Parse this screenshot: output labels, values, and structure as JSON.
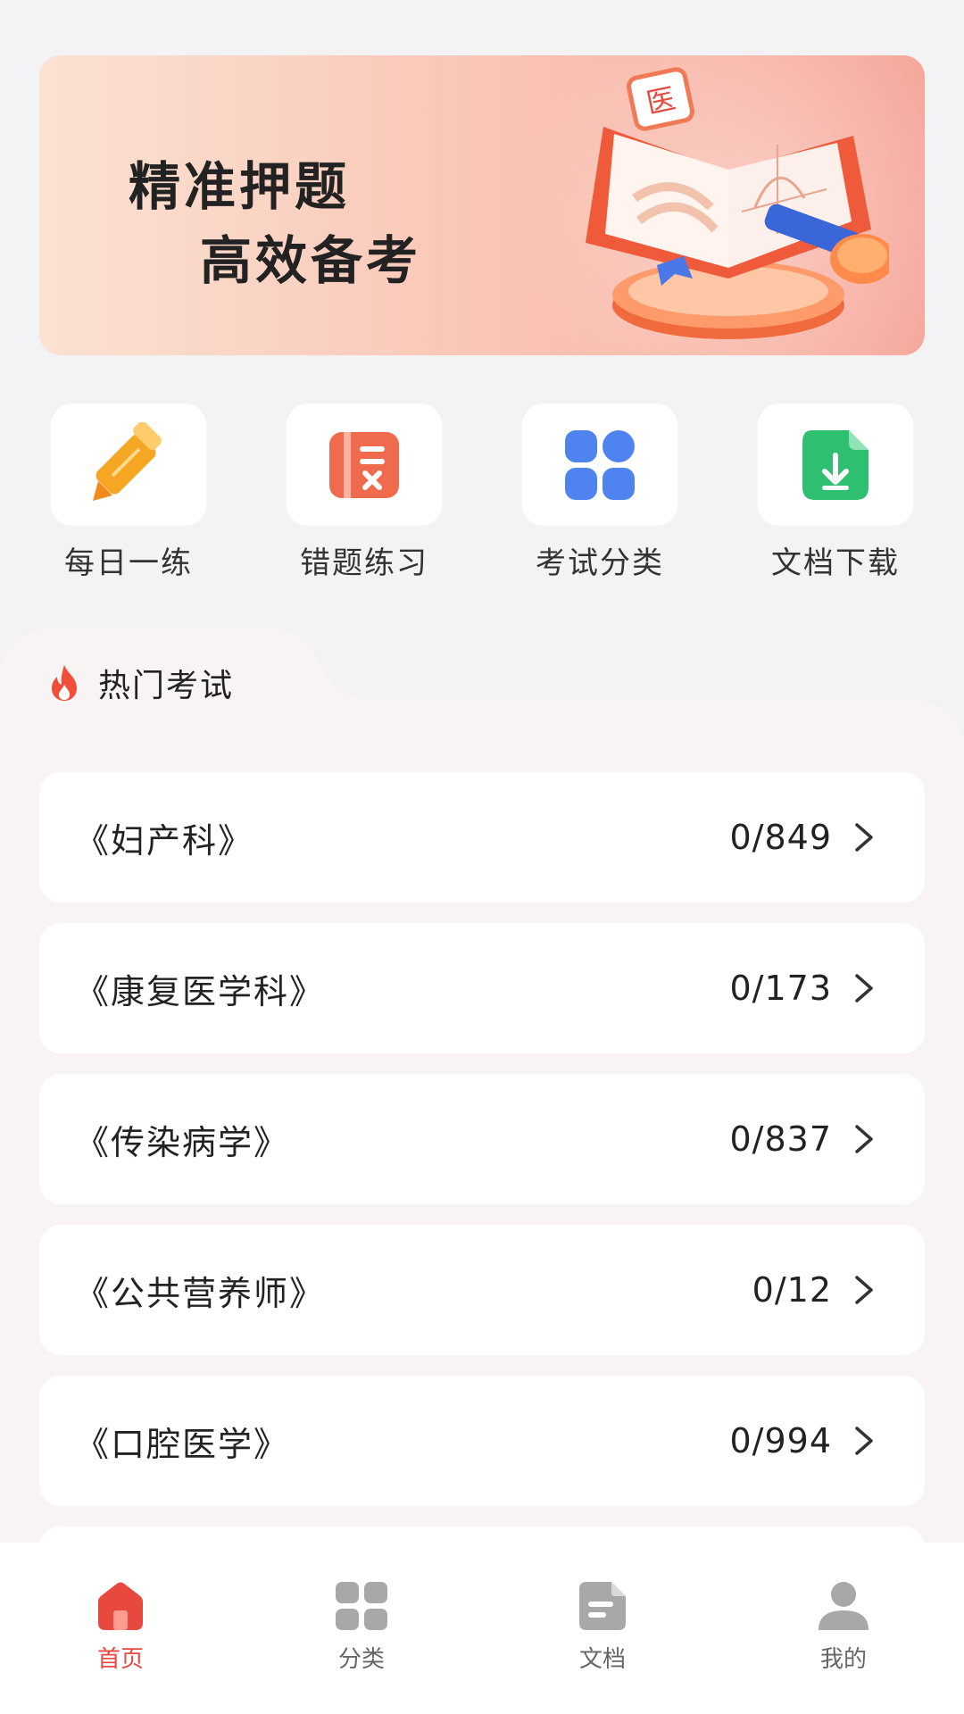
{
  "banner": {
    "line1": "精准押题",
    "line2": "高效备考",
    "badge": "医"
  },
  "shortcuts": [
    {
      "label": "每日一练",
      "icon": "pencil-icon",
      "color": "#f5a623"
    },
    {
      "label": "错题练习",
      "icon": "wrong-list-icon",
      "color": "#f06a4e"
    },
    {
      "label": "考试分类",
      "icon": "grid-icon",
      "color": "#4f83f0"
    },
    {
      "label": "文档下载",
      "icon": "download-doc-icon",
      "color": "#2fbf71"
    }
  ],
  "hot": {
    "title": "热门考试",
    "icon": "flame-icon",
    "items": [
      {
        "name": "《妇产科》",
        "count": "0/849"
      },
      {
        "name": "《康复医学科》",
        "count": "0/173"
      },
      {
        "name": "《传染病学》",
        "count": "0/837"
      },
      {
        "name": "《公共营养师》",
        "count": "0/12"
      },
      {
        "name": "《口腔医学》",
        "count": "0/994"
      }
    ]
  },
  "tabbar": {
    "active_color": "#e8493f",
    "inactive_color": "#a8a8a8",
    "tabs": [
      {
        "label": "首页",
        "icon": "home-icon",
        "active": true
      },
      {
        "label": "分类",
        "icon": "category-icon",
        "active": false
      },
      {
        "label": "文档",
        "icon": "document-icon",
        "active": false
      },
      {
        "label": "我的",
        "icon": "profile-icon",
        "active": false
      }
    ]
  }
}
